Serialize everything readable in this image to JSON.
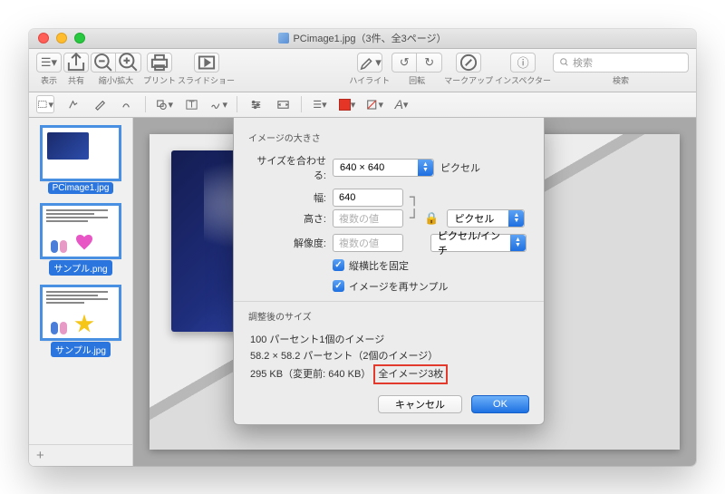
{
  "window": {
    "title": "PCimage1.jpg（3件、全3ページ）"
  },
  "toolbar": {
    "view": "表示",
    "share": "共有",
    "zoom": "縮小/拡大",
    "print": "プリント",
    "slideshow": "スライドショー",
    "highlight": "ハイライト",
    "rotate": "回転",
    "markup": "マークアップ",
    "inspector": "インスペクター",
    "searchPlaceholder": "検索",
    "searchLabel": "検索"
  },
  "sidebar": {
    "items": [
      {
        "label": "PCimage1.jpg"
      },
      {
        "label": "サンプル.png"
      },
      {
        "label": "サンプル.jpg"
      }
    ]
  },
  "dialog": {
    "section1": "イメージの大きさ",
    "fitLabel": "サイズを合わせる:",
    "fitValue": "640 × 640",
    "fitUnit": "ピクセル",
    "widthLabel": "幅:",
    "widthValue": "640",
    "heightLabel": "高さ:",
    "heightPlaceholder": "複数の値",
    "whUnit": "ピクセル",
    "resLabel": "解像度:",
    "resPlaceholder": "複数の値",
    "resUnit": "ピクセル/インチ",
    "lockRatio": "縦横比を固定",
    "resample": "イメージを再サンプル",
    "section2": "調整後のサイズ",
    "result1": "100 パーセント1個のイメージ",
    "result2": "58.2 × 58.2 パーセント（2個のイメージ）",
    "result3a": "295 KB（変更前: 640 KB）",
    "result3b": "全イメージ3枚",
    "cancel": "キャンセル",
    "ok": "OK"
  }
}
